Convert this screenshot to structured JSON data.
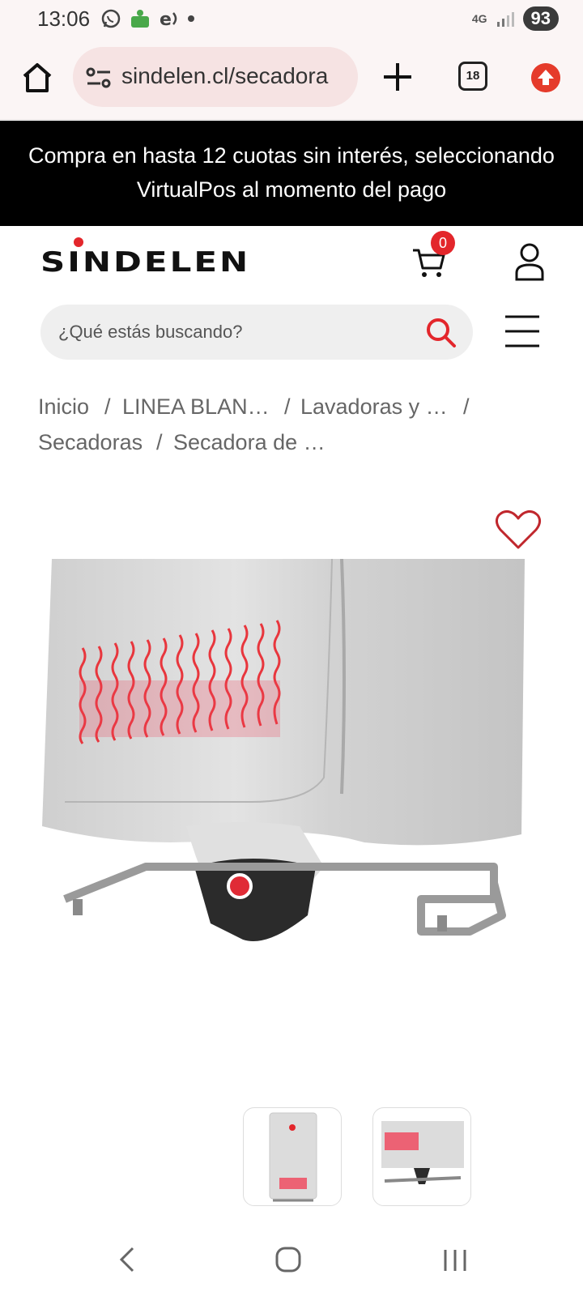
{
  "status_bar": {
    "time": "13:06",
    "network": "4G",
    "battery": "93"
  },
  "browser": {
    "url": "sindelen.cl/secadora",
    "tab_count": "18"
  },
  "promo_banner": {
    "line1": "Compra en hasta 12 cuotas sin interés, seleccionando",
    "line2": "VirtualPos al momento del pago"
  },
  "header": {
    "logo": "SINDELEN",
    "cart_count": "0"
  },
  "search": {
    "placeholder": "¿Qué estás buscando?"
  },
  "breadcrumb": {
    "items": [
      "Inicio",
      "LINEA BLAN…",
      "Lavadoras y …",
      "Secadoras",
      "Secadora de …"
    ],
    "separator": "/"
  },
  "colors": {
    "brand_red": "#e3262b",
    "banner_bg": "#000000"
  }
}
